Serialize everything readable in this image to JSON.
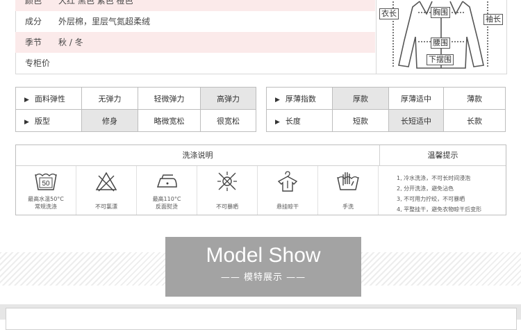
{
  "info": {
    "rows": [
      {
        "key": "颜色",
        "value": "大红 黑色 紫色 橙色"
      },
      {
        "key": "成分",
        "value": "外层棉，里层气氮超柔绒"
      },
      {
        "key": "季节",
        "value": "秋 / 冬"
      },
      {
        "key": "专柜价",
        "value": ""
      }
    ]
  },
  "diagram": {
    "labels": {
      "sleeve_length": "衣长",
      "chest": "胸围",
      "arm": "袖长",
      "waist": "腰围",
      "hem": "下摆围"
    }
  },
  "attributes_left": [
    {
      "name": "面料弹性",
      "options": [
        "无弹力",
        "轻微弹力",
        "高弹力"
      ],
      "selected": "高弹力"
    },
    {
      "name": "版型",
      "options": [
        "修身",
        "略微宽松",
        "很宽松"
      ],
      "selected": "修身"
    }
  ],
  "attributes_right": [
    {
      "name": "厚薄指数",
      "options": [
        "厚款",
        "厚薄适中",
        "薄款"
      ],
      "selected": "厚款"
    },
    {
      "name": "长度",
      "options": [
        "短款",
        "长短适中",
        "长款"
      ],
      "selected": "长短适中"
    }
  ],
  "wash": {
    "title": "洗涤说明",
    "tips_title": "温馨提示",
    "icons": [
      {
        "icon": "wash-50-icon",
        "label1": "最高水温50°C",
        "label2": "常规洗涤",
        "temp": "50"
      },
      {
        "icon": "no-bleach-icon",
        "label1": "不可氯漂",
        "label2": ""
      },
      {
        "icon": "iron-110-icon",
        "label1": "最高110°C",
        "label2": "反面熨烫"
      },
      {
        "icon": "no-sun-icon",
        "label1": "不可暴晒",
        "label2": ""
      },
      {
        "icon": "hang-dry-icon",
        "label1": "悬挂晾干",
        "label2": ""
      },
      {
        "icon": "hand-wash-icon",
        "label1": "手洗",
        "label2": ""
      }
    ],
    "tips": [
      "1, 冷水洗涤，不可长时间浸泡",
      "2, 分开洗涤，避免沾色",
      "3, 不可用力拧绞，不可暴晒",
      "4, 平整挂干，避免衣物晾干后变形"
    ]
  },
  "banner": {
    "title": "Model Show",
    "subtitle": "—— 模特展示 ——"
  }
}
